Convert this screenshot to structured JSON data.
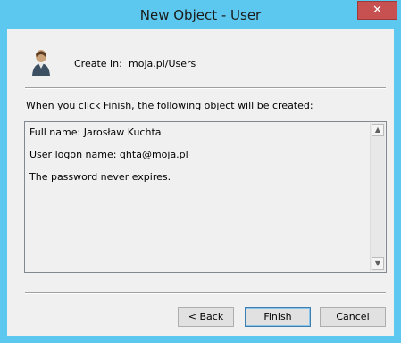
{
  "window": {
    "title": "New Object - User",
    "close_glyph": "✕"
  },
  "header": {
    "create_in_label": "Create in:",
    "create_in_value": "moja.pl/Users",
    "icon": "user-icon"
  },
  "intro_text": "When you click Finish, the following object will be created:",
  "summary": {
    "lines": [
      "Full name: Jarosław Kuchta",
      "User logon name: qhta@moja.pl",
      "The password never expires."
    ]
  },
  "scrollbar": {
    "up_glyph": "▲",
    "down_glyph": "▼"
  },
  "buttons": {
    "back": "< Back",
    "finish": "Finish",
    "cancel": "Cancel"
  },
  "colors": {
    "frame": "#5cc8ef",
    "client": "#f0f0f0",
    "close": "#c75050"
  }
}
